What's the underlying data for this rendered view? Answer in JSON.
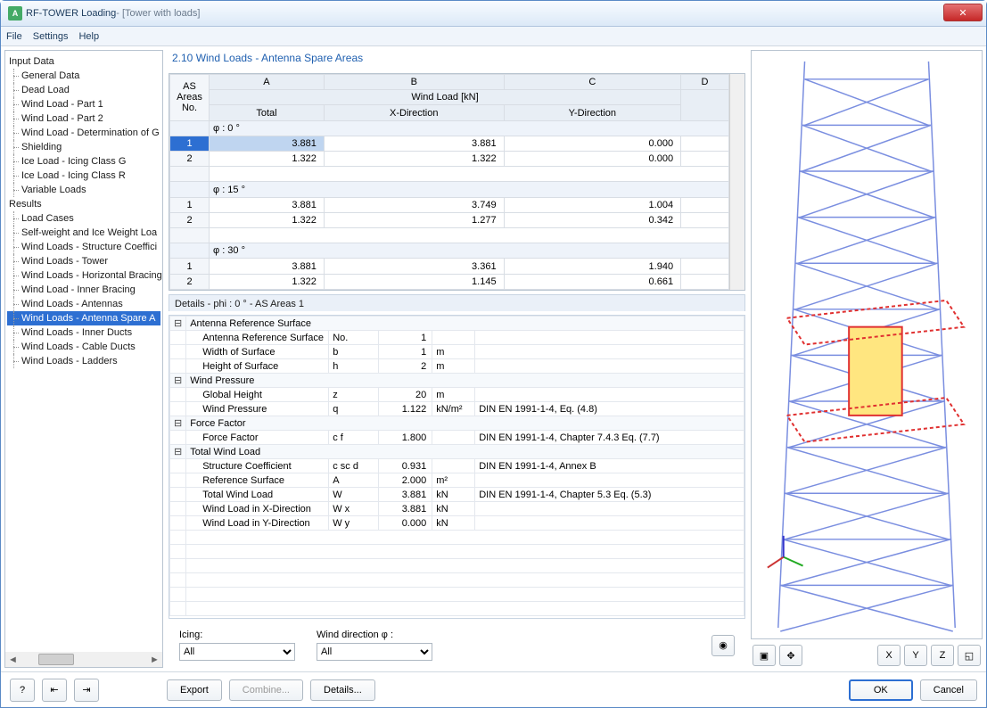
{
  "window": {
    "app_title": "RF-TOWER Loading",
    "doc_title": " - [Tower with loads]"
  },
  "menu": {
    "file": "File",
    "settings": "Settings",
    "help": "Help"
  },
  "tree": {
    "input_label": "Input Data",
    "input_items": [
      "General Data",
      "Dead Load",
      "Wind Load - Part 1",
      "Wind Load - Part 2",
      "Wind Load - Determination of G",
      "Shielding",
      "Ice Load - Icing Class G",
      "Ice Load - Icing Class R",
      "Variable Loads"
    ],
    "results_label": "Results",
    "results_items": [
      "Load Cases",
      "Self-weight and Ice Weight Loa",
      "Wind Loads - Structure Coeffici",
      "Wind Loads - Tower",
      "Wind Loads - Horizontal Bracing",
      "Wind Load - Inner Bracing",
      "Wind Loads - Antennas",
      "Wind Loads - Antenna Spare A",
      "Wind Loads - Inner Ducts",
      "Wind Loads - Cable Ducts",
      "Wind Loads - Ladders"
    ],
    "selected_result_index": 7
  },
  "section": {
    "title": "2.10 Wind Loads - Antenna Spare Areas"
  },
  "grid": {
    "col_letters": [
      "A",
      "B",
      "C",
      "D"
    ],
    "corner": "AS Areas\nNo.",
    "wind_load_hdr": "Wind Load [kN]",
    "sub_headers": [
      "Total",
      "X-Direction",
      "Y-Direction"
    ],
    "groups": [
      {
        "label": "φ : 0 °",
        "rows": [
          {
            "no": "1",
            "vals": [
              "3.881",
              "3.881",
              "0.000"
            ],
            "selected": true
          },
          {
            "no": "2",
            "vals": [
              "1.322",
              "1.322",
              "0.000"
            ]
          }
        ]
      },
      {
        "label": "φ : 15 °",
        "rows": [
          {
            "no": "1",
            "vals": [
              "3.881",
              "3.749",
              "1.004"
            ]
          },
          {
            "no": "2",
            "vals": [
              "1.322",
              "1.277",
              "0.342"
            ]
          }
        ]
      },
      {
        "label": "φ : 30 °",
        "rows": [
          {
            "no": "1",
            "vals": [
              "3.881",
              "3.361",
              "1.940"
            ]
          },
          {
            "no": "2",
            "vals": [
              "1.322",
              "1.145",
              "0.661"
            ]
          }
        ]
      }
    ]
  },
  "details": {
    "title": "Details  -  phi : 0 ° - AS Areas 1",
    "sections": [
      {
        "name": "Antenna Reference Surface",
        "rows": [
          {
            "lbl": "Antenna Reference Surface",
            "sym": "No.",
            "val": "1",
            "unit": "",
            "ref": ""
          },
          {
            "lbl": "Width of Surface",
            "sym": "b",
            "val": "1",
            "unit": "m",
            "ref": ""
          },
          {
            "lbl": "Height of Surface",
            "sym": "h",
            "val": "2",
            "unit": "m",
            "ref": ""
          }
        ]
      },
      {
        "name": "Wind Pressure",
        "rows": [
          {
            "lbl": "Global Height",
            "sym": "z",
            "val": "20",
            "unit": "m",
            "ref": ""
          },
          {
            "lbl": "Wind Pressure",
            "sym": "q",
            "val": "1.122",
            "unit": "kN/m²",
            "ref": "DIN EN 1991-1-4, Eq. (4.8)"
          }
        ]
      },
      {
        "name": "Force Factor",
        "rows": [
          {
            "lbl": "Force Factor",
            "sym": "c f",
            "val": "1.800",
            "unit": "",
            "ref": "DIN EN 1991-1-4, Chapter 7.4.3 Eq. (7.7)"
          }
        ]
      },
      {
        "name": "Total Wind Load",
        "rows": [
          {
            "lbl": "Structure Coefficient",
            "sym": "c sc d",
            "val": "0.931",
            "unit": "",
            "ref": "DIN EN 1991-1-4, Annex B"
          },
          {
            "lbl": "Reference Surface",
            "sym": "A",
            "val": "2.000",
            "unit": "m²",
            "ref": ""
          },
          {
            "lbl": "Total Wind Load",
            "sym": "W",
            "val": "3.881",
            "unit": "kN",
            "ref": "DIN EN 1991-1-4, Chapter 5.3 Eq. (5.3)"
          },
          {
            "lbl": "Wind Load in X-Direction",
            "sym": "W x",
            "val": "3.881",
            "unit": "kN",
            "ref": ""
          },
          {
            "lbl": "Wind Load in Y-Direction",
            "sym": "W y",
            "val": "0.000",
            "unit": "kN",
            "ref": ""
          }
        ]
      }
    ]
  },
  "controls": {
    "icing_label": "Icing:",
    "icing_value": "All",
    "winddir_label": "Wind direction φ :",
    "winddir_value": "All"
  },
  "buttons": {
    "export": "Export",
    "combine": "Combine...",
    "details": "Details...",
    "ok": "OK",
    "cancel": "Cancel"
  }
}
